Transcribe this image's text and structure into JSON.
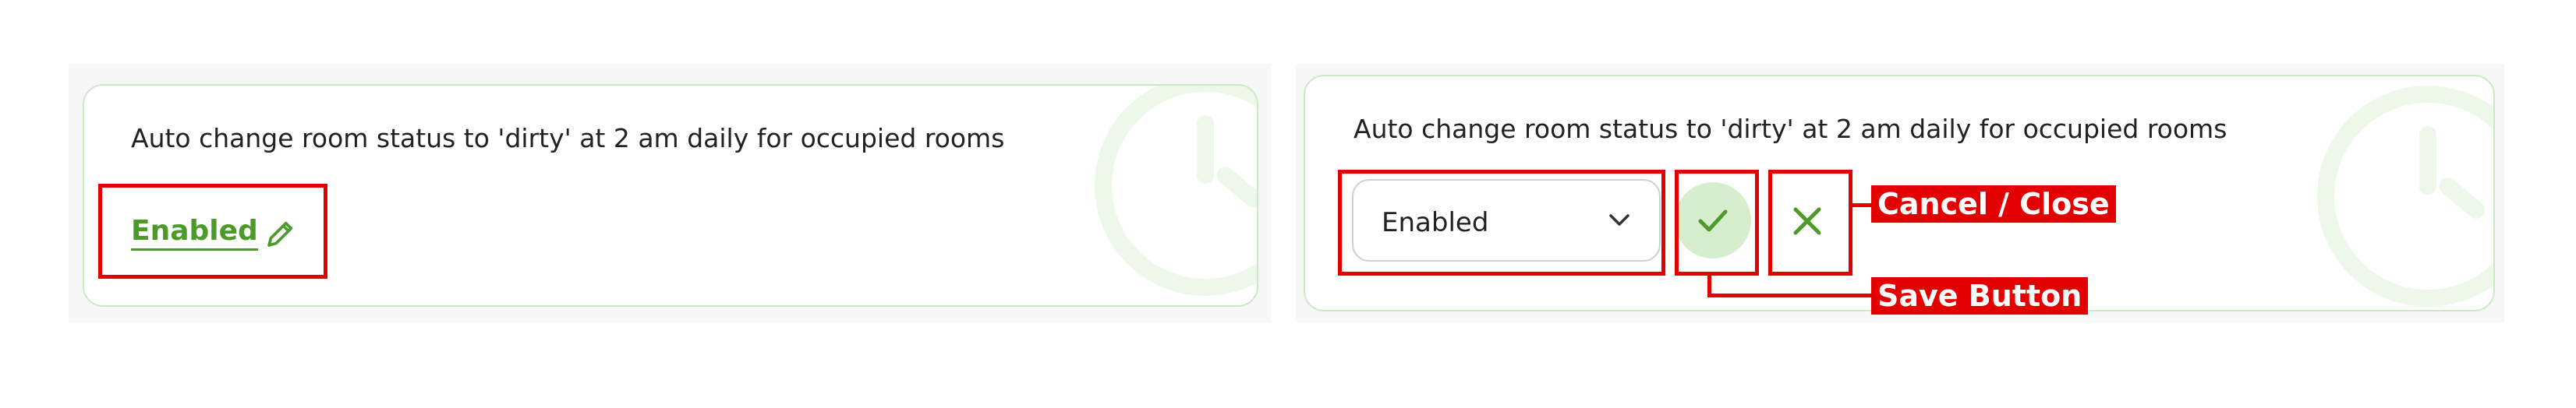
{
  "left_card": {
    "description": "Auto change room status to 'dirty' at 2 am daily for occupied rooms",
    "status_link": "Enabled"
  },
  "right_card": {
    "description": "Auto change room status to 'dirty' at 2 am daily for occupied rooms",
    "select_value": "Enabled"
  },
  "callouts": {
    "cancel": "Cancel / Close",
    "save": "Save Button"
  },
  "icons": {
    "background": "clock-icon",
    "edit": "pencil-icon",
    "dropdown": "chevron-down-icon",
    "save": "check-icon",
    "cancel": "close-icon"
  },
  "colors": {
    "accent": "#4c9a2a",
    "card_border": "#cde8c5",
    "save_bg": "#d6eecd",
    "annotation": "#e30000"
  }
}
